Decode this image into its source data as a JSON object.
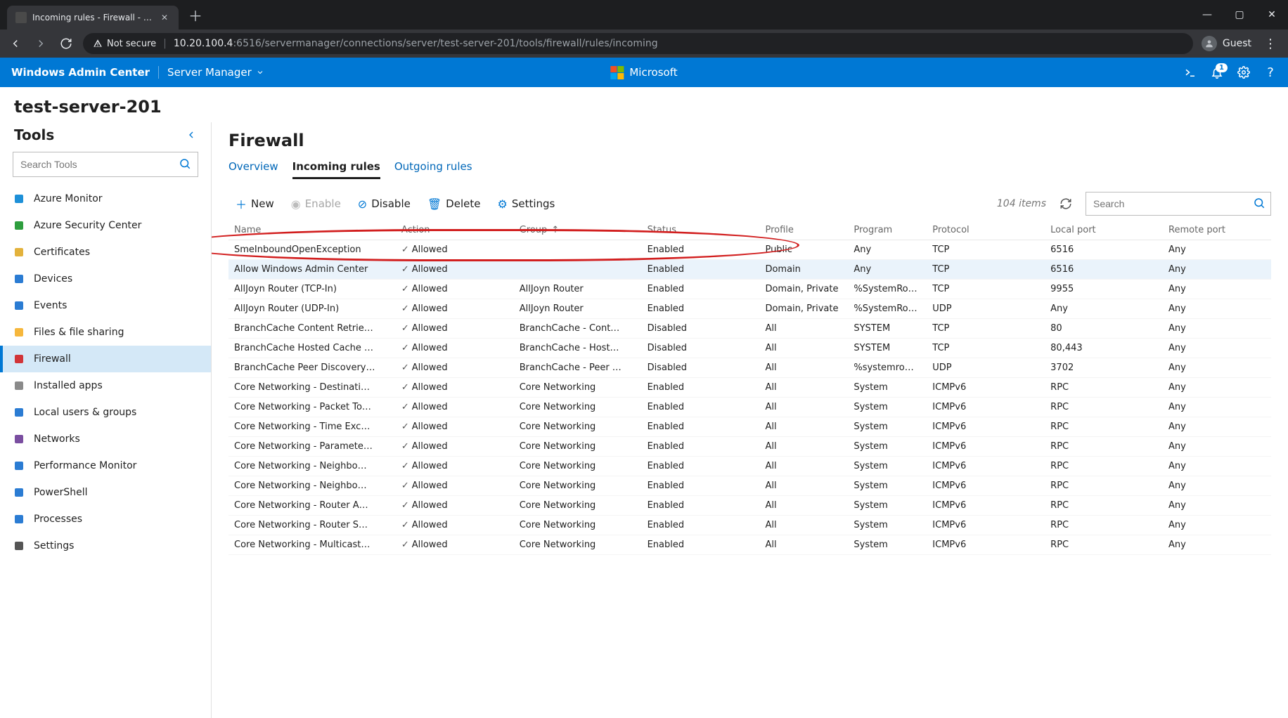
{
  "browser": {
    "tab_title": "Incoming rules - Firewall - Server…",
    "not_secure": "Not secure",
    "url_host": "10.20.100.4",
    "url_path": ":6516/servermanager/connections/server/test-server-201/tools/firewall/rules/incoming",
    "guest": "Guest"
  },
  "wac": {
    "brand": "Windows Admin Center",
    "crumb": "Server Manager",
    "ms": "Microsoft",
    "notif_count": "1"
  },
  "server_name": "test-server-201",
  "tools": {
    "heading": "Tools",
    "search_placeholder": "Search Tools",
    "items": [
      {
        "label": "Azure Monitor",
        "icon": "azure-monitor",
        "color": "#1e90d8"
      },
      {
        "label": "Azure Security Center",
        "icon": "shield",
        "color": "#2e9e3e"
      },
      {
        "label": "Certificates",
        "icon": "cert",
        "color": "#e3b23c"
      },
      {
        "label": "Devices",
        "icon": "devices",
        "color": "#2b7cd3"
      },
      {
        "label": "Events",
        "icon": "events",
        "color": "#2b7cd3"
      },
      {
        "label": "Files & file sharing",
        "icon": "folder",
        "color": "#f6b73c"
      },
      {
        "label": "Firewall",
        "icon": "firewall",
        "color": "#d13438",
        "selected": true
      },
      {
        "label": "Installed apps",
        "icon": "apps",
        "color": "#8a8a8a"
      },
      {
        "label": "Local users & groups",
        "icon": "users",
        "color": "#2b7cd3"
      },
      {
        "label": "Networks",
        "icon": "network",
        "color": "#7a4ea0"
      },
      {
        "label": "Performance Monitor",
        "icon": "perf",
        "color": "#2b7cd3"
      },
      {
        "label": "PowerShell",
        "icon": "ps",
        "color": "#2b7cd3"
      },
      {
        "label": "Processes",
        "icon": "proc",
        "color": "#2b7cd3"
      },
      {
        "label": "Settings",
        "icon": "gear",
        "color": "#555"
      }
    ]
  },
  "main": {
    "title": "Firewall",
    "tabs": {
      "overview": "Overview",
      "incoming": "Incoming rules",
      "outgoing": "Outgoing rules"
    },
    "toolbar": {
      "new": "New",
      "enable": "Enable",
      "disable": "Disable",
      "delete": "Delete",
      "settings": "Settings",
      "count": "104 items",
      "search_placeholder": "Search"
    },
    "columns": {
      "name": "Name",
      "action": "Action",
      "group": "Group",
      "status": "Status",
      "profile": "Profile",
      "program": "Program",
      "protocol": "Protocol",
      "localport": "Local port",
      "remoteport": "Remote port",
      "sort": "↑"
    },
    "rows": [
      {
        "name": "SmeInboundOpenException",
        "action": "Allowed",
        "group": "",
        "status": "Enabled",
        "profile": "Public",
        "program": "Any",
        "protocol": "TCP",
        "localport": "6516",
        "remoteport": "Any"
      },
      {
        "name": "Allow Windows Admin Center",
        "action": "Allowed",
        "group": "",
        "status": "Enabled",
        "profile": "Domain",
        "program": "Any",
        "protocol": "TCP",
        "localport": "6516",
        "remoteport": "Any",
        "highlight": true
      },
      {
        "name": "AllJoyn Router (TCP-In)",
        "action": "Allowed",
        "group": "AllJoyn Router",
        "status": "Enabled",
        "profile": "Domain, Private",
        "program": "%SystemRo…",
        "protocol": "TCP",
        "localport": "9955",
        "remoteport": "Any"
      },
      {
        "name": "AllJoyn Router (UDP-In)",
        "action": "Allowed",
        "group": "AllJoyn Router",
        "status": "Enabled",
        "profile": "Domain, Private",
        "program": "%SystemRo…",
        "protocol": "UDP",
        "localport": "Any",
        "remoteport": "Any"
      },
      {
        "name": "BranchCache Content Retrie…",
        "action": "Allowed",
        "group": "BranchCache - Cont…",
        "status": "Disabled",
        "profile": "All",
        "program": "SYSTEM",
        "protocol": "TCP",
        "localport": "80",
        "remoteport": "Any"
      },
      {
        "name": "BranchCache Hosted Cache …",
        "action": "Allowed",
        "group": "BranchCache - Host…",
        "status": "Disabled",
        "profile": "All",
        "program": "SYSTEM",
        "protocol": "TCP",
        "localport": "80,443",
        "remoteport": "Any"
      },
      {
        "name": "BranchCache Peer Discovery…",
        "action": "Allowed",
        "group": "BranchCache - Peer …",
        "status": "Disabled",
        "profile": "All",
        "program": "%systemro…",
        "protocol": "UDP",
        "localport": "3702",
        "remoteport": "Any"
      },
      {
        "name": "Core Networking - Destinati…",
        "action": "Allowed",
        "group": "Core Networking",
        "status": "Enabled",
        "profile": "All",
        "program": "System",
        "protocol": "ICMPv6",
        "localport": "RPC",
        "remoteport": "Any"
      },
      {
        "name": "Core Networking - Packet To…",
        "action": "Allowed",
        "group": "Core Networking",
        "status": "Enabled",
        "profile": "All",
        "program": "System",
        "protocol": "ICMPv6",
        "localport": "RPC",
        "remoteport": "Any"
      },
      {
        "name": "Core Networking - Time Exc…",
        "action": "Allowed",
        "group": "Core Networking",
        "status": "Enabled",
        "profile": "All",
        "program": "System",
        "protocol": "ICMPv6",
        "localport": "RPC",
        "remoteport": "Any"
      },
      {
        "name": "Core Networking - Paramete…",
        "action": "Allowed",
        "group": "Core Networking",
        "status": "Enabled",
        "profile": "All",
        "program": "System",
        "protocol": "ICMPv6",
        "localport": "RPC",
        "remoteport": "Any"
      },
      {
        "name": "Core Networking - Neighbo…",
        "action": "Allowed",
        "group": "Core Networking",
        "status": "Enabled",
        "profile": "All",
        "program": "System",
        "protocol": "ICMPv6",
        "localport": "RPC",
        "remoteport": "Any"
      },
      {
        "name": "Core Networking - Neighbo…",
        "action": "Allowed",
        "group": "Core Networking",
        "status": "Enabled",
        "profile": "All",
        "program": "System",
        "protocol": "ICMPv6",
        "localport": "RPC",
        "remoteport": "Any"
      },
      {
        "name": "Core Networking - Router A…",
        "action": "Allowed",
        "group": "Core Networking",
        "status": "Enabled",
        "profile": "All",
        "program": "System",
        "protocol": "ICMPv6",
        "localport": "RPC",
        "remoteport": "Any"
      },
      {
        "name": "Core Networking - Router S…",
        "action": "Allowed",
        "group": "Core Networking",
        "status": "Enabled",
        "profile": "All",
        "program": "System",
        "protocol": "ICMPv6",
        "localport": "RPC",
        "remoteport": "Any"
      },
      {
        "name": "Core Networking - Multicast…",
        "action": "Allowed",
        "group": "Core Networking",
        "status": "Enabled",
        "profile": "All",
        "program": "System",
        "protocol": "ICMPv6",
        "localport": "RPC",
        "remoteport": "Any"
      }
    ]
  }
}
